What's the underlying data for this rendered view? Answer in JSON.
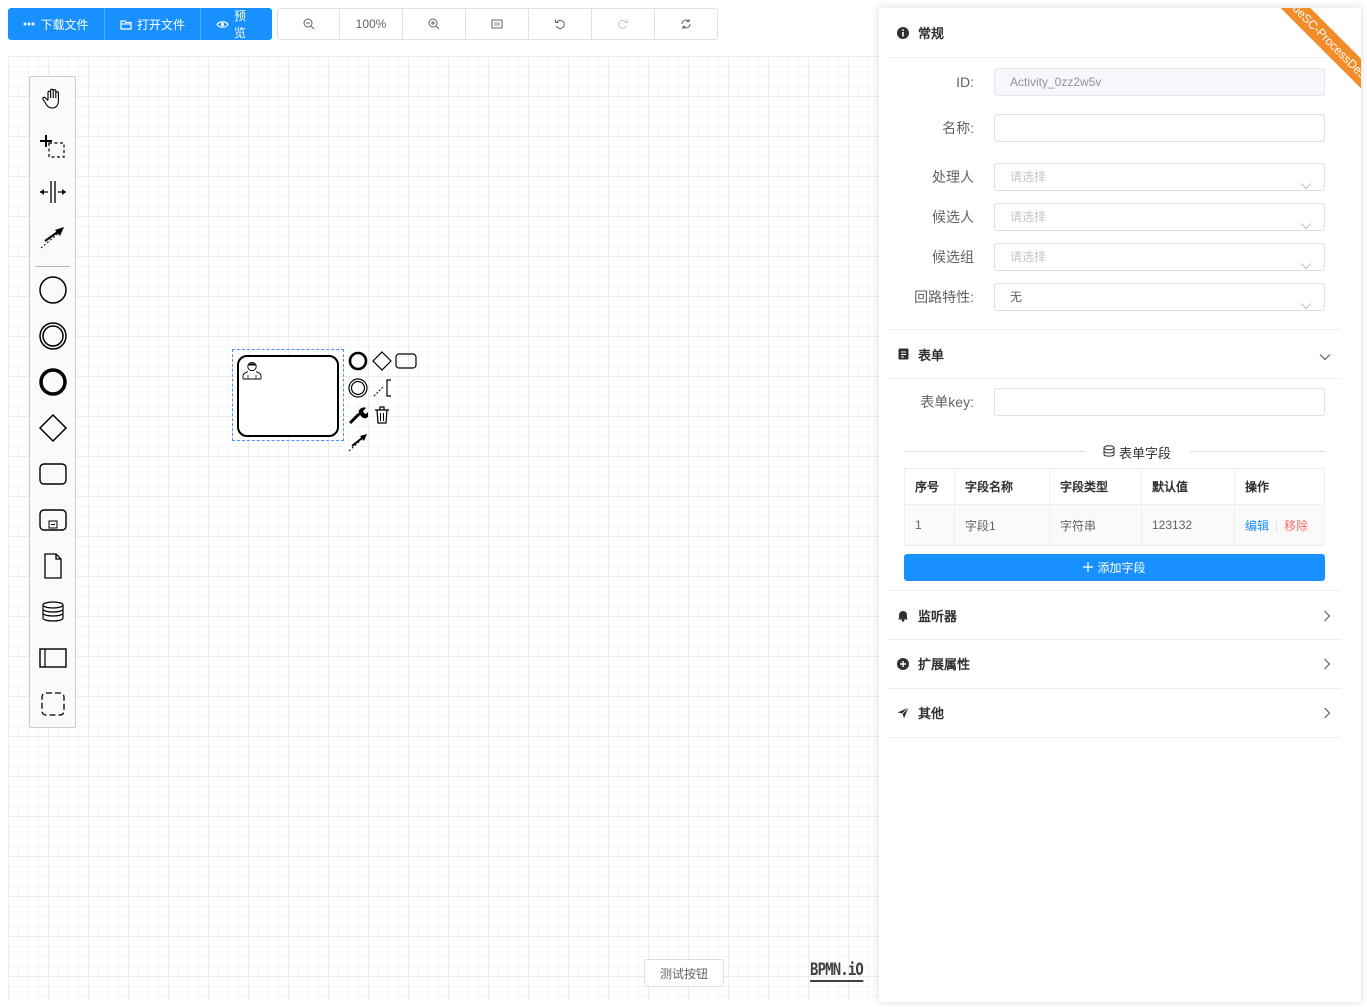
{
  "toolbar": {
    "download_label": "下载文件",
    "open_label": "打开文件",
    "preview_label": "预览",
    "zoom_level": "100%"
  },
  "canvas": {
    "test_button_label": "测试按钮",
    "logo_text": "BPMN.iO"
  },
  "panel": {
    "ribbon_text": "MiyueSC-ProcessDesigner",
    "general": {
      "title": "常规",
      "id_label": "ID:",
      "id_value": "Activity_0zz2w5v",
      "name_label": "名称:",
      "name_value": "",
      "assignee_label": "处理人",
      "candidate_users_label": "候选人",
      "candidate_groups_label": "候选组",
      "select_placeholder": "请选择",
      "loop_label": "回路特性:",
      "loop_value": "无"
    },
    "form": {
      "title": "表单",
      "key_label": "表单key:",
      "key_value": "",
      "fields_divider": "表单字段",
      "columns": [
        "序号",
        "字段名称",
        "字段类型",
        "默认值",
        "操作"
      ],
      "rows": [
        {
          "index": "1",
          "name": "字段1",
          "type": "字符串",
          "default": "123132",
          "edit": "编辑",
          "remove": "移除"
        }
      ],
      "add_label": "添加字段"
    },
    "listeners": {
      "title": "监听器"
    },
    "extensions": {
      "title": "扩展属性"
    },
    "other": {
      "title": "其他"
    }
  },
  "colors": {
    "primary": "#1890ff",
    "danger": "#f56c6c",
    "ribbon": "#f28c28"
  }
}
